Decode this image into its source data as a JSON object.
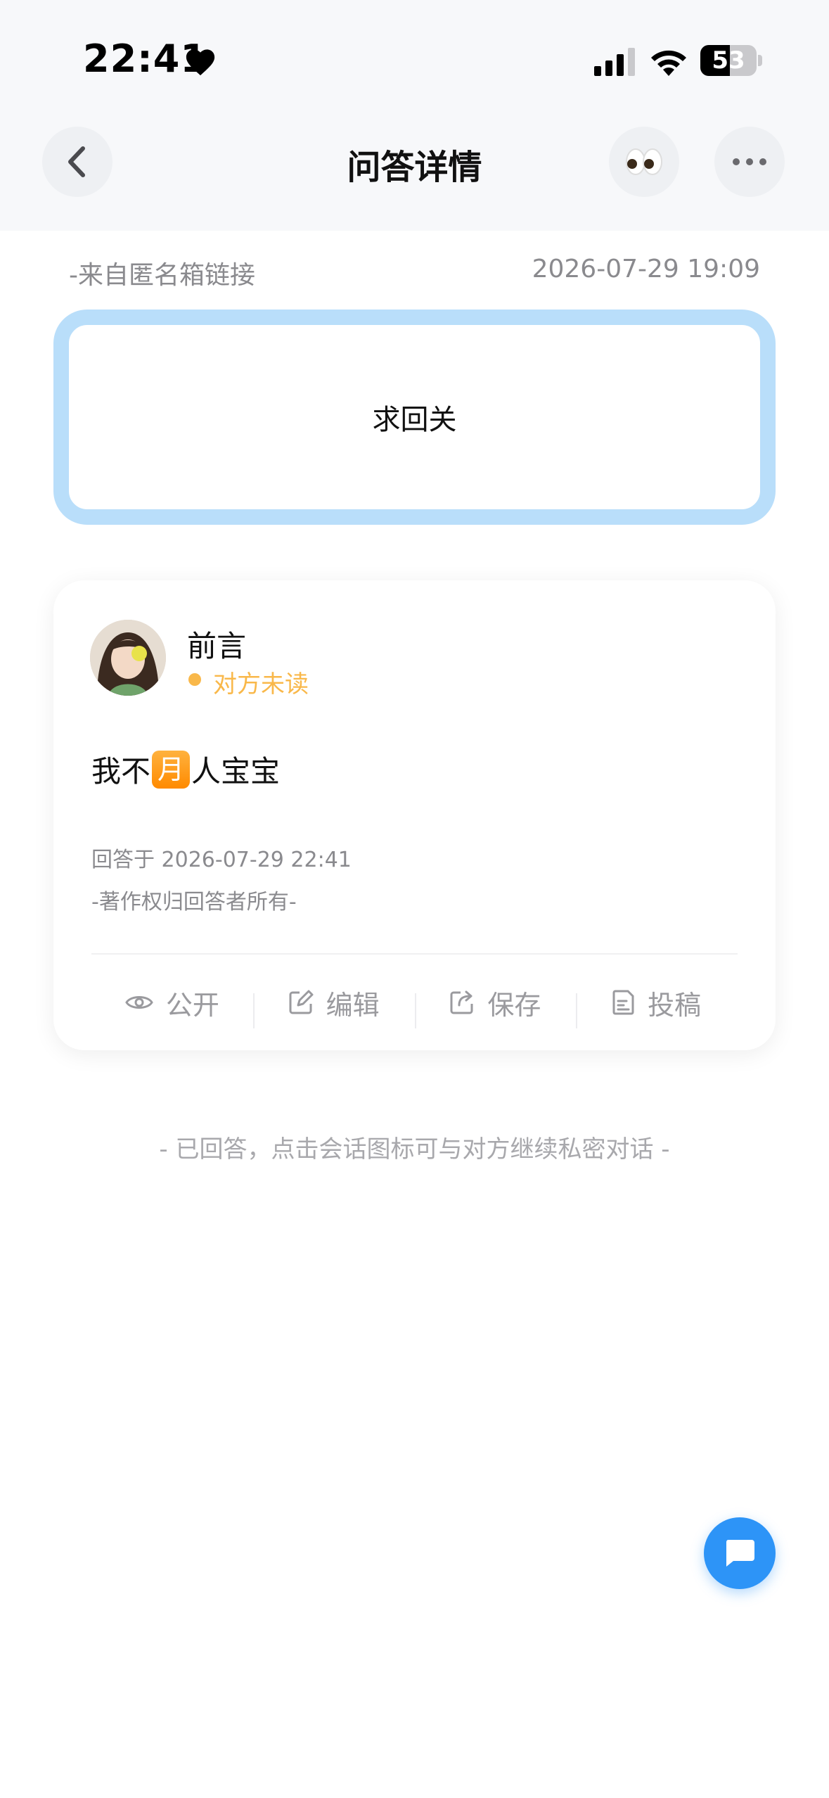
{
  "status_bar": {
    "time": "22:41",
    "battery_level": "53"
  },
  "header": {
    "title": "问答详情"
  },
  "question": {
    "source": "-来自匿名箱链接",
    "time": "2026-07-29 19:09",
    "text": "求回关"
  },
  "answer": {
    "user_name": "前言",
    "read_status": "对方未读",
    "text_before": "我不",
    "badge_char": "月",
    "text_after": "人宝宝",
    "answered_at": "回答于 2026-07-29 22:41",
    "copyright": "-著作权归回答者所有-"
  },
  "actions": [
    {
      "label": "公开",
      "icon": "eye-icon"
    },
    {
      "label": "编辑",
      "icon": "edit-icon"
    },
    {
      "label": "保存",
      "icon": "share-save-icon"
    },
    {
      "label": "投稿",
      "icon": "document-icon"
    }
  ],
  "hint": "- 已回答，点击会话图标可与对方继续私密对话 -",
  "colors": {
    "accent_blue": "#2d94f7",
    "question_border": "#b9defa",
    "unread_orange": "#f9b84a"
  }
}
